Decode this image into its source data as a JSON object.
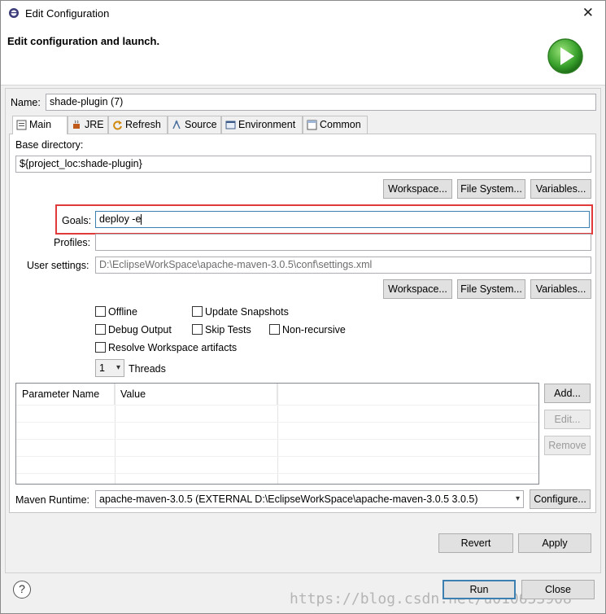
{
  "window": {
    "title": "Edit Configuration",
    "header": "Edit configuration and launch."
  },
  "name": {
    "label": "Name:",
    "value": "shade-plugin (7)"
  },
  "tabs": [
    {
      "label": "Main",
      "icon": "main-tab-icon"
    },
    {
      "label": "JRE",
      "icon": "jre-icon"
    },
    {
      "label": "Refresh",
      "icon": "refresh-icon"
    },
    {
      "label": "Source",
      "icon": "source-icon"
    },
    {
      "label": "Environment",
      "icon": "environment-icon"
    },
    {
      "label": "Common",
      "icon": "common-icon"
    }
  ],
  "base_dir": {
    "label": "Base directory:",
    "value": "${project_loc:shade-plugin}"
  },
  "buttons_row1": {
    "workspace": "Workspace...",
    "filesystem": "File System...",
    "variables": "Variables..."
  },
  "goals": {
    "label": "Goals:",
    "value": "deploy -e"
  },
  "profiles": {
    "label": "Profiles:",
    "value": ""
  },
  "user_settings": {
    "label": "User settings:",
    "value": "D:\\EclipseWorkSpace\\apache-maven-3.0.5\\conf\\settings.xml"
  },
  "buttons_row2": {
    "workspace": "Workspace...",
    "filesystem": "File System...",
    "variables": "Variables..."
  },
  "options": {
    "offline": "Offline",
    "update_snapshots": "Update Snapshots",
    "debug_output": "Debug Output",
    "skip_tests": "Skip Tests",
    "non_recursive": "Non-recursive",
    "resolve_workspace": "Resolve Workspace artifacts"
  },
  "threads": {
    "value": "1",
    "label": "Threads"
  },
  "params_table": {
    "columns": [
      "Parameter Name",
      "Value"
    ],
    "rows": []
  },
  "param_buttons": {
    "add": "Add...",
    "edit": "Edit...",
    "remove": "Remove"
  },
  "runtime": {
    "label": "Maven Runtime:",
    "value": "apache-maven-3.0.5 (EXTERNAL D:\\EclipseWorkSpace\\apache-maven-3.0.5 3.0.5)",
    "configure": "Configure..."
  },
  "actions": {
    "revert": "Revert",
    "apply": "Apply",
    "run": "Run",
    "close": "Close"
  },
  "help": "?",
  "watermark": "https://blog.csdn.net/u010653908"
}
